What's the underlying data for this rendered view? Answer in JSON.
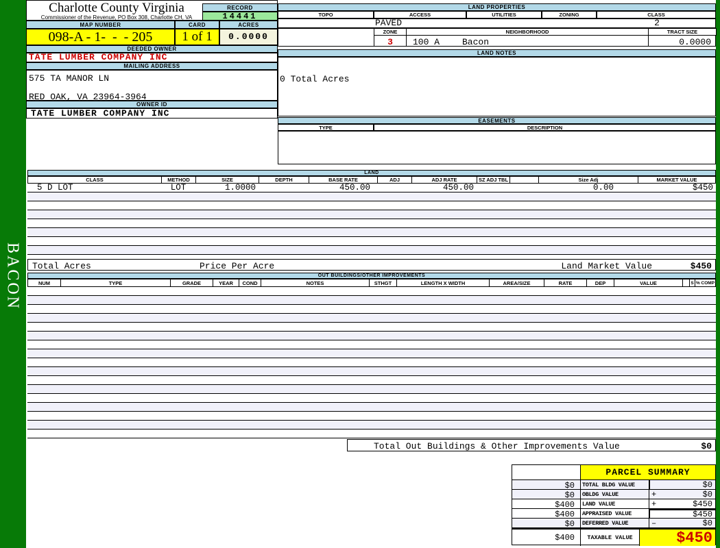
{
  "sidebar": {
    "district": "BACON"
  },
  "header": {
    "county": "Charlotte County Virginia",
    "commissioner": "Commissioner of the Revenue, PO Box 308, Charlotte CH, VA",
    "record_label": "RECORD",
    "record_value": "14441",
    "map_number_label": "MAP NUMBER",
    "map_number_value": "098-A - 1-  -  - 205",
    "card_label": "CARD",
    "card_value": "1 of 1",
    "acres_label": "ACRES",
    "acres_value": "0.0000"
  },
  "owner": {
    "deeded_owner_label": "DEEDED OWNER",
    "deeded_owner": "TATE LUMBER COMPANY INC",
    "mailing_address_label": "MAILING ADDRESS",
    "address_line1": "575 TA MANOR LN",
    "address_line2": "RED OAK, VA 23964-3964",
    "owner_id_label": "OWNER ID",
    "owner_id": "TATE LUMBER COMPANY INC"
  },
  "land_properties": {
    "title": "LAND PROPERTIES",
    "headers": [
      "TOPO",
      "ACCESS",
      "UTILITIES",
      "ZONING",
      "CLASS"
    ],
    "topo": "",
    "access": "PAVED",
    "utilities": "",
    "zoning": "",
    "class": "2",
    "zone_label": "ZONE",
    "zone": "3",
    "neighborhood_label": "NEIGHBORHOOD",
    "neighborhood_code": "100 A",
    "neighborhood_name": "Bacon",
    "tract_size_label": "TRACT SIZE",
    "tract_size": "0.0000"
  },
  "land_notes": {
    "title": "LAND NOTES",
    "note": "0 Total Acres"
  },
  "easements": {
    "title": "EASEMENTS",
    "type_label": "TYPE",
    "description_label": "DESCRIPTION"
  },
  "land": {
    "title": "LAND",
    "headers": [
      "CLASS",
      "METHOD",
      "SIZE",
      "DEPTH",
      "BASE RATE",
      "ADJ",
      "ADJ RATE",
      "SZ ADJ TBL",
      "",
      "Size Adj",
      "MARKET VALUE"
    ],
    "rows": [
      [
        "5 D LOT",
        "LOT",
        "1.0000",
        "",
        "450.00",
        "",
        "450.00",
        "",
        "",
        "0.00",
        "$450"
      ]
    ],
    "empty_row_count": 7,
    "total_acres_label": "Total Acres",
    "price_per_acre_label": "Price Per Acre",
    "market_value_label": "Land Market Value",
    "market_value": "$450"
  },
  "out_buildings": {
    "title": "OUT BUILDINGS/OTHER IMPROVEMENTS",
    "headers": [
      "NUM",
      "TYPE",
      "GRADE",
      "YEAR",
      "COND",
      "NOTES",
      "STHGT",
      "LENGTH X WIDTH",
      "AREA/SIZE",
      "RATE",
      "DEP",
      "VALUE",
      "S",
      "% COMP"
    ],
    "empty_row_count": 17,
    "total_label": "Total Out Buildings & Other Improvements Value",
    "total_value": "$0"
  },
  "parcel_summary": {
    "title": "PARCEL SUMMARY",
    "rows": [
      {
        "prior": "$0",
        "label": "TOTAL BLDG VALUE",
        "op": "",
        "value": "$0"
      },
      {
        "prior": "$0",
        "label": "OBLDG VALUE",
        "op": "+",
        "value": "$0"
      },
      {
        "prior": "$400",
        "label": "LAND VALUE",
        "op": "+",
        "value": "$450"
      },
      {
        "prior": "$400",
        "label": "APPRAISED VALUE",
        "op": "",
        "value": "$450"
      },
      {
        "prior": "$0",
        "label": "DEFERRED VALUE",
        "op": "–",
        "value": "$0"
      }
    ],
    "taxable": {
      "prior": "$400",
      "label": "TAXABLE VALUE",
      "value": "$450"
    }
  },
  "colors": {
    "sidebar_green": "#077A07",
    "header_blue": "#B3D9E8",
    "record_green": "#9BE89B",
    "highlight_yellow": "#FFFF00",
    "acres_beige": "#F4F4DE",
    "alert_red": "#CC0000",
    "row_stripe": "#F1F1FA"
  }
}
